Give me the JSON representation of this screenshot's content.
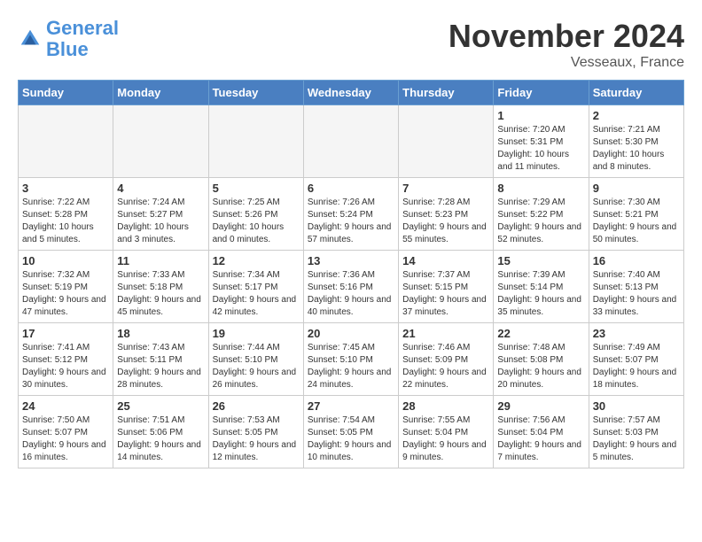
{
  "header": {
    "logo_general": "General",
    "logo_blue": "Blue",
    "month_title": "November 2024",
    "location": "Vesseaux, France"
  },
  "days_of_week": [
    "Sunday",
    "Monday",
    "Tuesday",
    "Wednesday",
    "Thursday",
    "Friday",
    "Saturday"
  ],
  "weeks": [
    [
      {
        "day": "",
        "empty": true
      },
      {
        "day": "",
        "empty": true
      },
      {
        "day": "",
        "empty": true
      },
      {
        "day": "",
        "empty": true
      },
      {
        "day": "",
        "empty": true
      },
      {
        "day": "1",
        "sunrise": "7:20 AM",
        "sunset": "5:31 PM",
        "daylight": "10 hours and 11 minutes."
      },
      {
        "day": "2",
        "sunrise": "7:21 AM",
        "sunset": "5:30 PM",
        "daylight": "10 hours and 8 minutes."
      }
    ],
    [
      {
        "day": "3",
        "sunrise": "7:22 AM",
        "sunset": "5:28 PM",
        "daylight": "10 hours and 5 minutes."
      },
      {
        "day": "4",
        "sunrise": "7:24 AM",
        "sunset": "5:27 PM",
        "daylight": "10 hours and 3 minutes."
      },
      {
        "day": "5",
        "sunrise": "7:25 AM",
        "sunset": "5:26 PM",
        "daylight": "10 hours and 0 minutes."
      },
      {
        "day": "6",
        "sunrise": "7:26 AM",
        "sunset": "5:24 PM",
        "daylight": "9 hours and 57 minutes."
      },
      {
        "day": "7",
        "sunrise": "7:28 AM",
        "sunset": "5:23 PM",
        "daylight": "9 hours and 55 minutes."
      },
      {
        "day": "8",
        "sunrise": "7:29 AM",
        "sunset": "5:22 PM",
        "daylight": "9 hours and 52 minutes."
      },
      {
        "day": "9",
        "sunrise": "7:30 AM",
        "sunset": "5:21 PM",
        "daylight": "9 hours and 50 minutes."
      }
    ],
    [
      {
        "day": "10",
        "sunrise": "7:32 AM",
        "sunset": "5:19 PM",
        "daylight": "9 hours and 47 minutes."
      },
      {
        "day": "11",
        "sunrise": "7:33 AM",
        "sunset": "5:18 PM",
        "daylight": "9 hours and 45 minutes."
      },
      {
        "day": "12",
        "sunrise": "7:34 AM",
        "sunset": "5:17 PM",
        "daylight": "9 hours and 42 minutes."
      },
      {
        "day": "13",
        "sunrise": "7:36 AM",
        "sunset": "5:16 PM",
        "daylight": "9 hours and 40 minutes."
      },
      {
        "day": "14",
        "sunrise": "7:37 AM",
        "sunset": "5:15 PM",
        "daylight": "9 hours and 37 minutes."
      },
      {
        "day": "15",
        "sunrise": "7:39 AM",
        "sunset": "5:14 PM",
        "daylight": "9 hours and 35 minutes."
      },
      {
        "day": "16",
        "sunrise": "7:40 AM",
        "sunset": "5:13 PM",
        "daylight": "9 hours and 33 minutes."
      }
    ],
    [
      {
        "day": "17",
        "sunrise": "7:41 AM",
        "sunset": "5:12 PM",
        "daylight": "9 hours and 30 minutes."
      },
      {
        "day": "18",
        "sunrise": "7:43 AM",
        "sunset": "5:11 PM",
        "daylight": "9 hours and 28 minutes."
      },
      {
        "day": "19",
        "sunrise": "7:44 AM",
        "sunset": "5:10 PM",
        "daylight": "9 hours and 26 minutes."
      },
      {
        "day": "20",
        "sunrise": "7:45 AM",
        "sunset": "5:10 PM",
        "daylight": "9 hours and 24 minutes."
      },
      {
        "day": "21",
        "sunrise": "7:46 AM",
        "sunset": "5:09 PM",
        "daylight": "9 hours and 22 minutes."
      },
      {
        "day": "22",
        "sunrise": "7:48 AM",
        "sunset": "5:08 PM",
        "daylight": "9 hours and 20 minutes."
      },
      {
        "day": "23",
        "sunrise": "7:49 AM",
        "sunset": "5:07 PM",
        "daylight": "9 hours and 18 minutes."
      }
    ],
    [
      {
        "day": "24",
        "sunrise": "7:50 AM",
        "sunset": "5:07 PM",
        "daylight": "9 hours and 16 minutes."
      },
      {
        "day": "25",
        "sunrise": "7:51 AM",
        "sunset": "5:06 PM",
        "daylight": "9 hours and 14 minutes."
      },
      {
        "day": "26",
        "sunrise": "7:53 AM",
        "sunset": "5:05 PM",
        "daylight": "9 hours and 12 minutes."
      },
      {
        "day": "27",
        "sunrise": "7:54 AM",
        "sunset": "5:05 PM",
        "daylight": "9 hours and 10 minutes."
      },
      {
        "day": "28",
        "sunrise": "7:55 AM",
        "sunset": "5:04 PM",
        "daylight": "9 hours and 9 minutes."
      },
      {
        "day": "29",
        "sunrise": "7:56 AM",
        "sunset": "5:04 PM",
        "daylight": "9 hours and 7 minutes."
      },
      {
        "day": "30",
        "sunrise": "7:57 AM",
        "sunset": "5:03 PM",
        "daylight": "9 hours and 5 minutes."
      }
    ]
  ]
}
